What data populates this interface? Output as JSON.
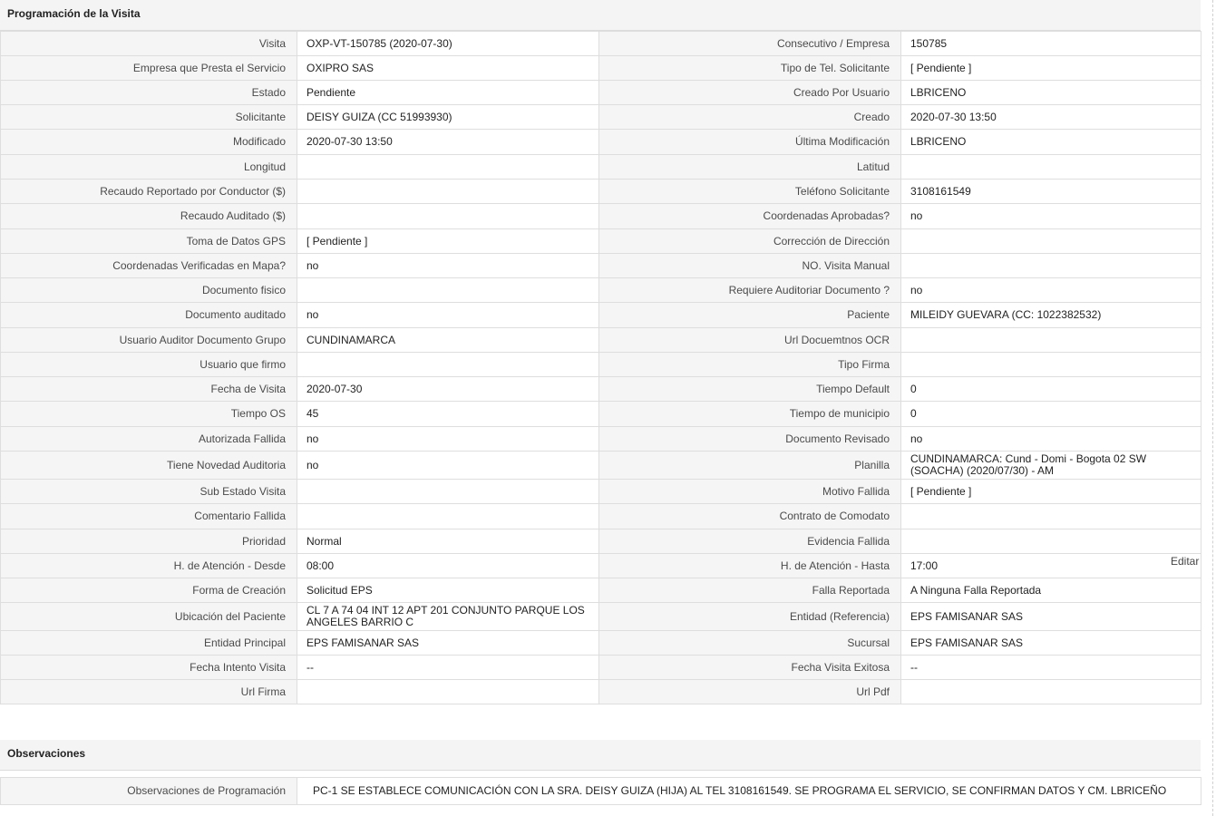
{
  "sections": {
    "programacion_title": "Programación de la Visita",
    "observaciones_title": "Observaciones"
  },
  "edit_label": "Editar",
  "fields": [
    [
      "Visita",
      "OXP-VT-150785 (2020-07-30)",
      "Consecutivo / Empresa",
      "150785"
    ],
    [
      "Empresa que Presta el Servicio",
      "OXIPRO SAS",
      "Tipo de Tel. Solicitante",
      "[ Pendiente ]"
    ],
    [
      "Estado",
      "Pendiente",
      "Creado Por Usuario",
      "LBRICENO"
    ],
    [
      "Solicitante",
      "DEISY GUIZA (CC 51993930)",
      "Creado",
      "2020-07-30 13:50"
    ],
    [
      "Modificado",
      "2020-07-30 13:50",
      "Última Modificación",
      " LBRICENO"
    ],
    [
      "Longitud",
      "",
      "Latitud",
      ""
    ],
    [
      "Recaudo Reportado por Conductor ($)",
      "",
      "Teléfono Solicitante",
      "3108161549"
    ],
    [
      "Recaudo Auditado ($)",
      "",
      "Coordenadas Aprobadas?",
      " no"
    ],
    [
      "Toma de Datos GPS",
      "[ Pendiente ]",
      "Corrección de Dirección",
      ""
    ],
    [
      "Coordenadas Verificadas en Mapa?",
      " no",
      "NO. Visita Manual",
      ""
    ],
    [
      "Documento fisico",
      "",
      "Requiere Auditoriar Documento ?",
      " no"
    ],
    [
      "Documento auditado",
      " no",
      "Paciente",
      "MILEIDY GUEVARA (CC: 1022382532)"
    ],
    [
      "Usuario Auditor Documento Grupo",
      "CUNDINAMARCA",
      "Url Docuemtnos OCR",
      ""
    ],
    [
      "Usuario que firmo",
      "",
      "Tipo Firma",
      ""
    ],
    [
      "Fecha de Visita",
      " 2020-07-30",
      "Tiempo Default",
      "0"
    ],
    [
      "Tiempo OS",
      "45",
      "Tiempo de municipio",
      "0"
    ],
    [
      "Autorizada Fallida",
      " no",
      "Documento Revisado",
      " no"
    ],
    [
      "Tiene Novedad Auditoria",
      " no",
      "Planilla",
      "CUNDINAMARCA: Cund - Domi - Bogota 02 SW (SOACHA) (2020/07/30) - AM"
    ],
    [
      "Sub Estado Visita",
      "",
      "Motivo Fallida",
      "[ Pendiente ]"
    ],
    [
      "Comentario Fallida",
      "",
      "Contrato de Comodato",
      ""
    ],
    [
      "Prioridad",
      "Normal",
      "Evidencia Fallida",
      ""
    ],
    [
      "H. de Atención - Desde",
      "08:00",
      "H. de Atención - Hasta",
      "17:00"
    ],
    [
      "Forma de Creación",
      "Solicitud EPS",
      "Falla Reportada",
      "A Ninguna Falla Reportada"
    ],
    [
      "Ubicación del Paciente",
      "CL 7 A 74 04 INT 12 APT 201 CONJUNTO PARQUE LOS ANGELES BARRIO C",
      "Entidad (Referencia)",
      "EPS FAMISANAR SAS"
    ],
    [
      "Entidad Principal",
      "EPS FAMISANAR SAS",
      "Sucursal",
      "EPS FAMISANAR SAS"
    ],
    [
      "Fecha Intento Visita",
      "--",
      "Fecha Visita Exitosa",
      "--"
    ],
    [
      "Url Firma",
      "",
      "Url Pdf",
      ""
    ]
  ],
  "observaciones": {
    "label": "Observaciones de Programación",
    "value": "PC-1 SE ESTABLECE COMUNICACIÓN CON LA SRA. DEISY GUIZA (HIJA) AL TEL 3108161549. SE PROGRAMA EL SERVICIO, SE CONFIRMAN DATOS Y CM. LBRICEÑO"
  }
}
